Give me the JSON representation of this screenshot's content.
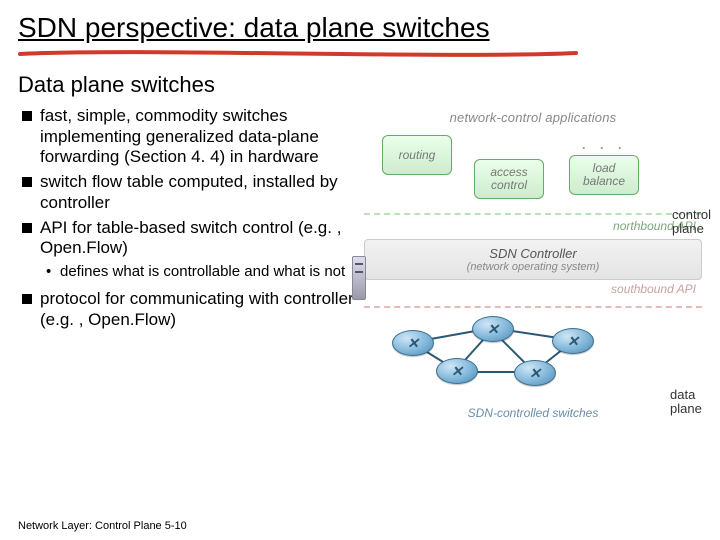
{
  "title": "SDN perspective: data plane switches",
  "subtitle": "Data plane switches",
  "bullets": [
    "fast, simple, commodity switches implementing generalized data-plane forwarding (Section 4. 4) in hardware",
    "switch flow table computed, installed by controller",
    "API for table-based switch control (e.g. , Open.Flow)",
    "protocol for communicating with controller (e.g. , Open.Flow)"
  ],
  "sub_bullet": "defines what is controllable and what is not",
  "right": {
    "apps_header": "network-control applications",
    "routing": "routing",
    "access": "access control",
    "load": "load balance",
    "dots": ". . .",
    "north": "northbound API",
    "south": "southbound API",
    "controller_t1": "SDN Controller",
    "controller_t2": "(network operating system)",
    "switches_caption": "SDN-controlled switches",
    "control_plane": "control plane",
    "data_plane": "data plane"
  },
  "footer": "Network Layer: Control Plane 5-10",
  "colors": {
    "underline": "#d03a2b"
  }
}
